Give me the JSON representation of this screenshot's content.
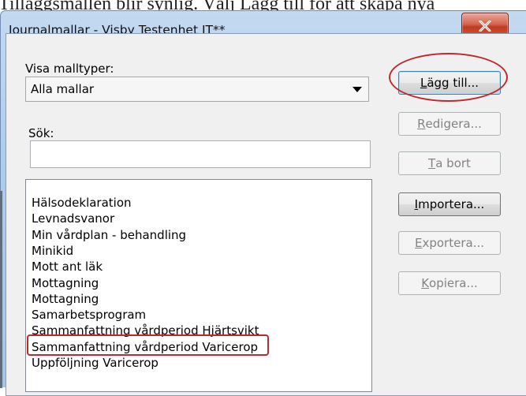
{
  "document_text": "Tilläggsmallen blir synlig. Välj Lägg till för att skapa nya",
  "window": {
    "title": "Journalmallar - Visby Testenhet  IT**",
    "close_icon": "close-x-icon"
  },
  "filter": {
    "label": "Visa malltyper:",
    "selected": "Alla mallar"
  },
  "search": {
    "label": "Sök:",
    "value": "",
    "placeholder": ""
  },
  "templates": [
    "Hälsodeklaration",
    "Levnadsvanor",
    "Min vårdplan - behandling",
    "Minikid",
    "Mott ant läk",
    "Mottagning",
    "Mottagning",
    "Samarbetsprogram",
    "Sammanfattning vårdperiod Hjärtsvikt",
    "Sammanfattning vårdperiod Varicerop",
    "Uppföljning Varicerop"
  ],
  "buttons": {
    "add": {
      "pre": "",
      "accel": "L",
      "post": "ägg till...",
      "enabled": true
    },
    "edit": {
      "pre": "",
      "accel": "R",
      "post": "edigera...",
      "enabled": false
    },
    "delete": {
      "pre": "",
      "accel": "T",
      "post": "a bort",
      "enabled": false
    },
    "import": {
      "pre": "",
      "accel": "I",
      "post": "mportera...",
      "enabled": true
    },
    "export": {
      "pre": "",
      "accel": "E",
      "post": "xportera...",
      "enabled": false
    },
    "copy": {
      "pre": "",
      "accel": "K",
      "post": "opiera...",
      "enabled": false
    }
  },
  "annotation_color": "#c0282e"
}
